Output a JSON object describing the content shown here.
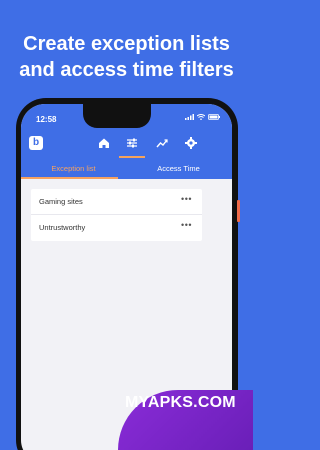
{
  "promo": {
    "line1": "Create exception lists",
    "line2": "and access time filters"
  },
  "status": {
    "time": "12:58"
  },
  "nav": {
    "logo_letter": "b",
    "icons": [
      "home-icon",
      "filters-icon",
      "stats-icon",
      "settings-icon"
    ]
  },
  "tabs": [
    {
      "label": "Exception list",
      "active": true
    },
    {
      "label": "Access Time",
      "active": false
    }
  ],
  "list": {
    "items": [
      {
        "label": "Gaming sites",
        "action": "•••"
      },
      {
        "label": "Untrustworthy",
        "action": "•••"
      }
    ]
  },
  "watermark": {
    "text": "MYAPKS.COM"
  },
  "colors": {
    "brand_blue": "#3f6ee6",
    "accent_orange": "#f6a261",
    "watermark_purple": "#7b27c9"
  }
}
